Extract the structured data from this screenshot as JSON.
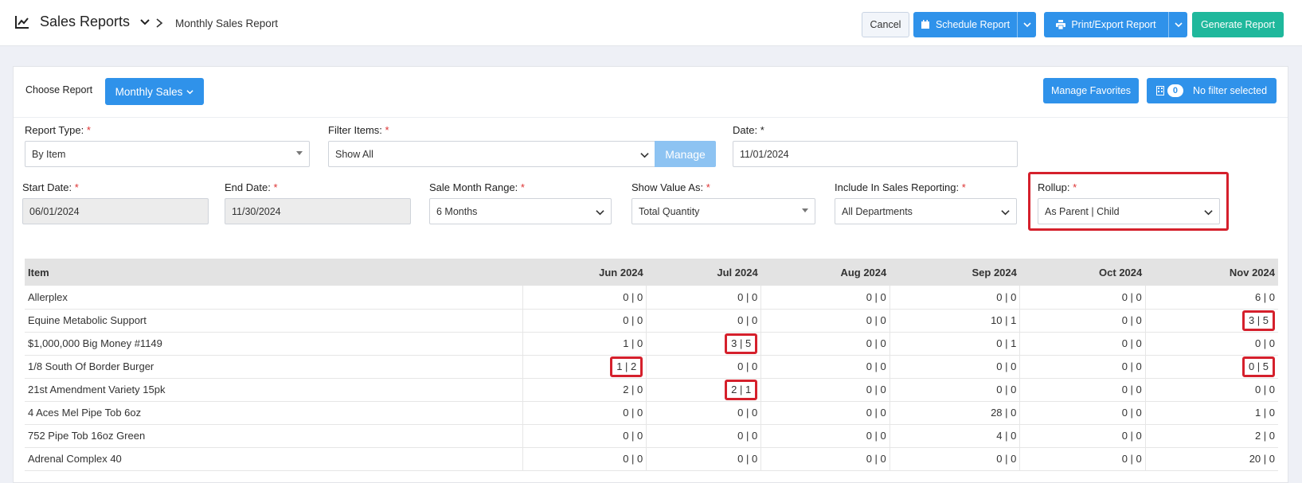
{
  "header": {
    "title": "Sales Reports",
    "breadcrumb": "Monthly Sales Report",
    "buttons": {
      "cancel": "Cancel",
      "schedule": "Schedule Report",
      "print": "Print/Export Report",
      "generate": "Generate Report"
    }
  },
  "toolbar": {
    "choose_label": "Choose Report",
    "choose_value": "Monthly Sales",
    "manage_favorites": "Manage Favorites",
    "filter_count": "0",
    "filter_label": "No filter selected"
  },
  "form": {
    "report_type": {
      "label": "Report Type:",
      "value": "By Item"
    },
    "filter_items": {
      "label": "Filter Items:",
      "value": "Show All",
      "manage": "Manage"
    },
    "date": {
      "label": "Date:",
      "value": "11/01/2024"
    },
    "start_date": {
      "label": "Start Date:",
      "value": "06/01/2024"
    },
    "end_date": {
      "label": "End Date:",
      "value": "11/30/2024"
    },
    "sale_month_range": {
      "label": "Sale Month Range:",
      "value": "6 Months"
    },
    "show_value_as": {
      "label": "Show Value As:",
      "value": "Total Quantity"
    },
    "include_in_sales": {
      "label": "Include In Sales Reporting:",
      "value": "All Departments"
    },
    "rollup": {
      "label": "Rollup:",
      "value": "As Parent | Child"
    }
  },
  "table": {
    "columns": [
      "Item",
      "Jun 2024",
      "Jul 2024",
      "Aug 2024",
      "Sep 2024",
      "Oct 2024",
      "Nov 2024"
    ],
    "rows": [
      [
        "Allerplex",
        "0 | 0",
        "0 | 0",
        "0 | 0",
        "0 | 0",
        "0 | 0",
        "6 | 0"
      ],
      [
        "Equine Metabolic Support",
        "0 | 0",
        "0 | 0",
        "0 | 0",
        "10 | 1",
        "0 | 0",
        "3 | 5"
      ],
      [
        "$1,000,000 Big Money #1149",
        "1 | 0",
        "3 | 5",
        "0 | 0",
        "0 | 1",
        "0 | 0",
        "0 | 0"
      ],
      [
        "1/8 South Of Border Burger",
        "1 | 2",
        "0 | 0",
        "0 | 0",
        "0 | 0",
        "0 | 0",
        "0 | 5"
      ],
      [
        "21st Amendment Variety 15pk",
        "2 | 0",
        "2 | 1",
        "0 | 0",
        "0 | 0",
        "0 | 0",
        "0 | 0"
      ],
      [
        "4 Aces Mel Pipe Tob 6oz",
        "0 | 0",
        "0 | 0",
        "0 | 0",
        "28 | 0",
        "0 | 0",
        "1 | 0"
      ],
      [
        "752 Pipe Tob 16oz Green",
        "0 | 0",
        "0 | 0",
        "0 | 0",
        "4 | 0",
        "0 | 0",
        "2 | 0"
      ],
      [
        "Adrenal Complex 40",
        "0 | 0",
        "0 | 0",
        "0 | 0",
        "0 | 0",
        "0 | 0",
        "20 | 0"
      ]
    ],
    "highlighted": [
      "1-6",
      "2-2",
      "3-1",
      "3-6",
      "4-2"
    ]
  },
  "colors": {
    "primary": "#2f92ea",
    "success": "#1fb89c",
    "highlight": "#d5202c"
  }
}
